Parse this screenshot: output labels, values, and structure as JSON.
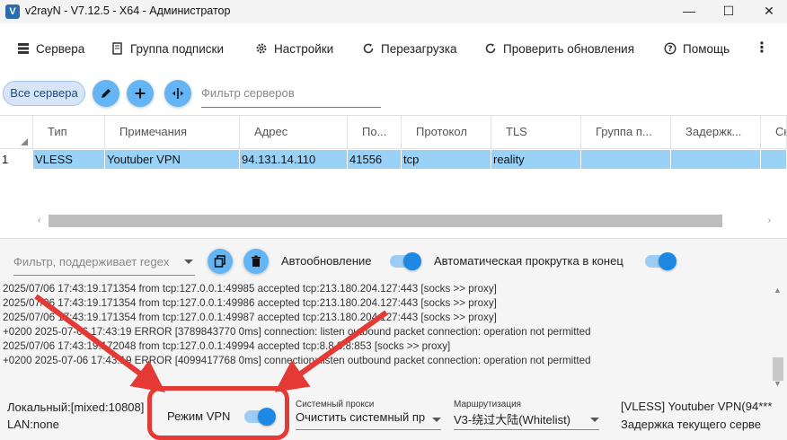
{
  "window": {
    "title": "v2rayN - V7.12.5 - X64 - Администратор",
    "app_icon": "V",
    "minimize_icon": "—",
    "maximize_icon": "☐",
    "close_icon": "✕"
  },
  "menu": {
    "servers": "Сервера",
    "subscription_group": "Группа подписки",
    "settings": "Настройки",
    "reload": "Перезагрузка",
    "check_updates": "Проверить обновления",
    "help": "Помощь",
    "more": "⋮"
  },
  "toolbar": {
    "all_servers": "Все сервера",
    "edit_icon": "pencil-icon",
    "add_icon": "plus-icon",
    "speed_icon": "speed-test-icon",
    "filter_placeholder": "Фильтр серверов"
  },
  "grid": {
    "columns": [
      "Тип",
      "Примечания",
      "Адрес",
      "По...",
      "Протокол",
      "TLS",
      "Группа п...",
      "Задержк...",
      "Ск"
    ],
    "rows": [
      {
        "index": "1",
        "type": "VLESS",
        "remarks": "Youtuber VPN",
        "address": "94.131.14.110",
        "port": "41556",
        "protocol": "tcp",
        "tls": "reality",
        "group": "",
        "delay": "",
        "speed": ""
      }
    ],
    "scroll_left": "‹",
    "scroll_right": "›"
  },
  "log_panel": {
    "filter_placeholder": "Фильтр, поддерживает regex",
    "auto_refresh_label": "Автообновление",
    "auto_refresh_on": true,
    "auto_scroll_label": "Автоматическая прокрутка в конец",
    "auto_scroll_on": true,
    "lines": [
      "2025/07/06 17:43:19.171354 from tcp:127.0.0.1:49985 accepted tcp:213.180.204.127:443 [socks >> proxy]",
      "2025/07/06 17:43:19.171354 from tcp:127.0.0.1:49986 accepted tcp:213.180.204.127:443 [socks >> proxy]",
      "2025/07/06 17:43:19.171354 from tcp:127.0.0.1:49987 accepted tcp:213.180.204.127:443 [socks >> proxy]",
      "+0200 2025-07-06 17:43:19 ERROR [3789843770 0ms] connection: listen outbound packet connection: operation not permitted",
      "2025/07/06 17:43:19.172048 from tcp:127.0.0.1:49994 accepted tcp:8.8.8.8:853 [socks >> proxy]",
      "+0200 2025-07-06 17:43:19 ERROR [4099417768 0ms] connection: listen outbound packet connection: operation not permitted"
    ]
  },
  "statusbar": {
    "local": "Локальный:[mixed:10808]",
    "lan": "LAN:none",
    "vpn_mode_label": "Режим VPN",
    "vpn_mode_on": true,
    "system_proxy_caption": "Системный прокси",
    "system_proxy_value": "Очистить системный пр",
    "routing_caption": "Маршрутизация",
    "routing_value": "V3-绕过大陆(Whitelist)",
    "current_server": "[VLESS] Youtuber VPN(94***",
    "current_delay": "Задержка текущего серве"
  },
  "colors": {
    "accent": "#1e88e5",
    "selected_row": "#9ad1f7",
    "annotation_red": "#e53935",
    "fab": "#64b5f6"
  }
}
